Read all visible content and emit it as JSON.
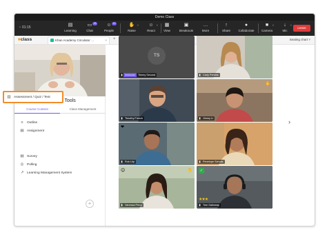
{
  "window": {
    "title": "Demo Class",
    "timer": "01:15"
  },
  "toolbar": {
    "buttons": [
      {
        "label": "Learning",
        "icon": "learning-icon",
        "glyph": "▤"
      },
      {
        "label": "Chat",
        "icon": "chat-icon",
        "glyph": "▭",
        "badge": "23"
      },
      {
        "label": "People",
        "icon": "people-icon",
        "glyph": "☺",
        "badge": "12"
      },
      {
        "label": "Raise",
        "icon": "raise-hand-icon",
        "glyph": "✋"
      },
      {
        "label": "React",
        "icon": "react-icon",
        "glyph": "☺"
      },
      {
        "label": "View",
        "icon": "view-icon",
        "glyph": "▦"
      },
      {
        "label": "Breakouts",
        "icon": "breakouts-icon",
        "glyph": "▣"
      },
      {
        "label": "More",
        "icon": "more-icon",
        "glyph": "…"
      },
      {
        "label": "Share",
        "icon": "share-icon",
        "glyph": "↑"
      },
      {
        "label": "Collaborate",
        "icon": "collaborate-icon",
        "glyph": "●"
      },
      {
        "label": "Camera",
        "icon": "camera-icon",
        "glyph": "■"
      },
      {
        "label": "Mic",
        "icon": "mic-icon",
        "glyph": "↓"
      }
    ],
    "leave_label": "Leave"
  },
  "tabbar": {
    "logo_prefix": "■",
    "logo_text": "class",
    "tab_label": "Khan Academy Circulator …",
    "tab_close": "×",
    "add_tab": "+",
    "seating_chart": "Seating chart ˅"
  },
  "presenter": {
    "role": "Instructor",
    "name": "Annie Malley"
  },
  "learning_tools": {
    "title": "Learning Tools",
    "tabs": [
      "Course Content",
      "Class Management"
    ],
    "items": [
      {
        "label": "Outline",
        "icon": "outline-icon",
        "glyph": "≡"
      },
      {
        "label": "Assignment",
        "icon": "assignment-icon",
        "glyph": "▤"
      },
      {
        "label": "Assessment / Quiz / Test",
        "icon": "assessment-icon",
        "glyph": "▥"
      },
      {
        "label": "Survey",
        "icon": "survey-icon",
        "glyph": "▤"
      },
      {
        "label": "Polling",
        "icon": "polling-icon",
        "glyph": "◎"
      },
      {
        "label": "Learning Management System",
        "icon": "lms-icon",
        "glyph": "↗"
      }
    ],
    "collapse_glyph": "‹›"
  },
  "participants": [
    {
      "name": "Timmy Second",
      "role": "Instructor",
      "initials": "TS"
    },
    {
      "name": "Carly Perkins"
    },
    {
      "name": "Timothy French"
    },
    {
      "name": "Jimmy Li",
      "hand": true
    },
    {
      "name": "Rob Lilp",
      "emoji": true
    },
    {
      "name": "Penelope Schultz"
    },
    {
      "name": "Vanessa Perry",
      "hand": true,
      "emoji": true
    },
    {
      "name": "Tom Galloway",
      "check": true,
      "stars": "★★★"
    }
  ],
  "next_page_glyph": "›",
  "colors": {
    "accent": "#6e5ae6",
    "leave": "#e03b3b",
    "highlight": "#f28c28",
    "hand": "#f6c44a",
    "check": "#2fae4a"
  }
}
